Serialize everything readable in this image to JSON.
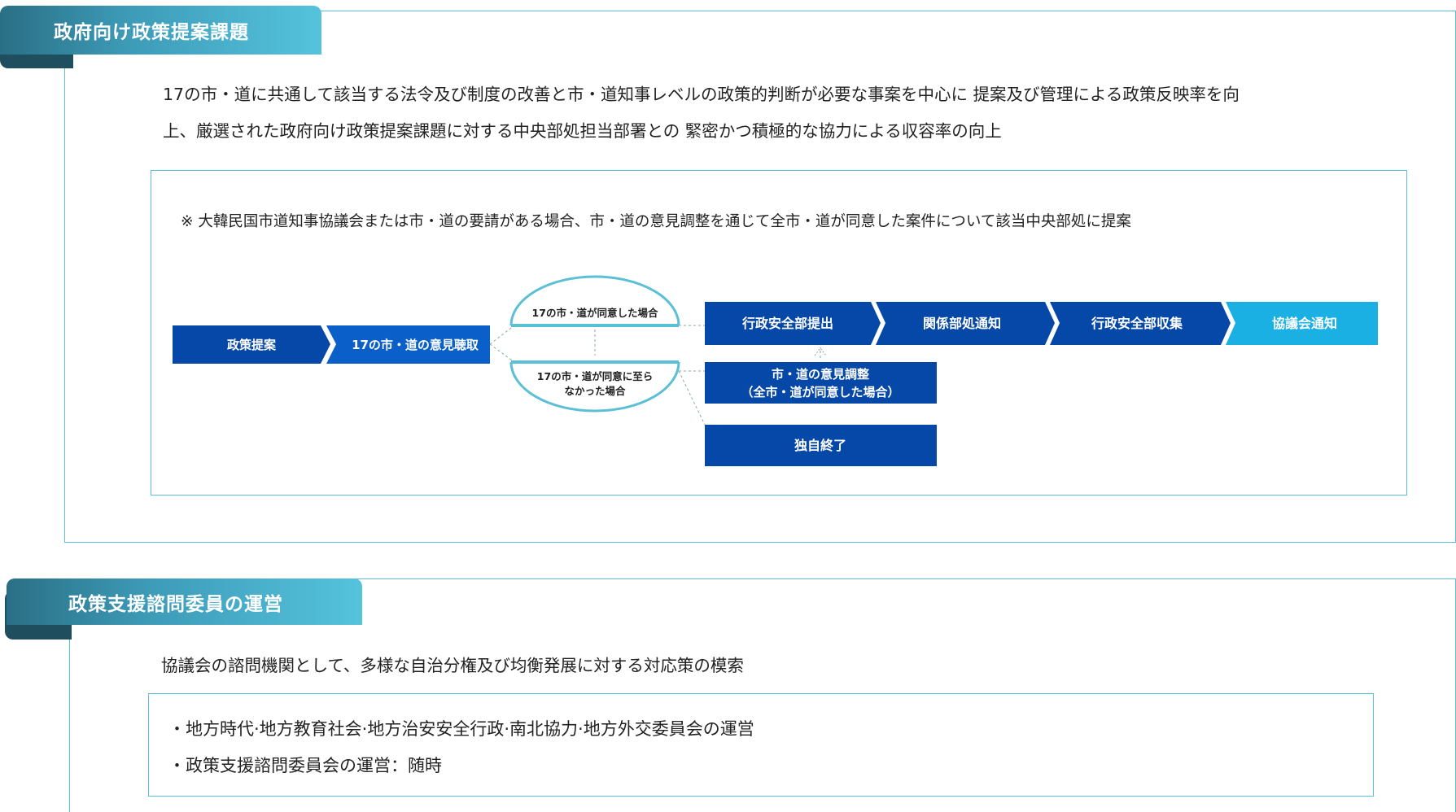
{
  "section1": {
    "title": "政府向け政策提案課題",
    "desc_line1": "17の市・道に共通して該当する法令及び制度の改善と市・道知事レベルの政策的判断が必要な事案を中心に 提案及び管理による政策反映率を向",
    "desc_line2": "上、厳選された政府向け政策提案課題に対する中央部処担当部署との 緊密かつ積極的な協力による収容率の向上",
    "note": "※ 大韓民国市道知事協議会または市・道の要請がある場合、市・道の意見調整を通じて全市・道が同意した案件について該当中央部処に提案",
    "flow": {
      "step_proposal": "政策提案",
      "step_hearing": "17の市・道の意見聴取",
      "branch_agree": "17の市・道が同意した場合",
      "branch_disagree_1": "17の市・道が同意に至ら",
      "branch_disagree_2": "なかった場合",
      "step_submit": "行政安全部提出",
      "step_notify_dept": "関係部処通知",
      "step_collect": "行政安全部収集",
      "step_notify_council": "協議会通知",
      "step_adjust_1": "市・道の意見調整",
      "step_adjust_2": "（全市・道が同意した場合）",
      "step_end": "独自終了"
    }
  },
  "section2": {
    "title": "政策支援諮問委員の運営",
    "desc": "協議会の諮問機関として、多様な自治分権及び均衡発展に対する対応策の模索",
    "bullets": [
      "・地方時代·地方教育社会·地方治安安全行政·南北協力·地方外交委員会の運営",
      "・政策支援諮問委員会の運営：随時"
    ]
  },
  "colors": {
    "dark_blue": "#0648a8",
    "mid_blue": "#0a60c8",
    "cyan": "#1ab0e3",
    "border": "#5bbfd6"
  }
}
